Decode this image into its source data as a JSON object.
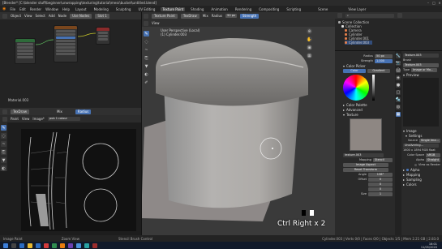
{
  "window": {
    "title": "[Blender* [C:\\blender stuff\\beginner\\unwrapping\\texturing\\tutorial\\mess\\bucket\\untitled.blend]"
  },
  "menu": [
    "File",
    "Edit",
    "Render",
    "Window",
    "Help"
  ],
  "workspace_tabs": [
    {
      "label": "Layout",
      "active": false
    },
    {
      "label": "Modeling",
      "active": false
    },
    {
      "label": "Sculpting",
      "active": false
    },
    {
      "label": "UV Editing",
      "active": false
    },
    {
      "label": "Texture Paint",
      "active": true
    },
    {
      "label": "Shading",
      "active": false
    },
    {
      "label": "Animation",
      "active": false
    },
    {
      "label": "Rendering",
      "active": false
    },
    {
      "label": "Compositing",
      "active": false
    },
    {
      "label": "Scripting",
      "active": false
    }
  ],
  "scene": {
    "label": "Scene",
    "view_layer": "View Layer"
  },
  "node_editor": {
    "header": [
      "Object",
      "View",
      "Select",
      "Add",
      "Node",
      "Use Nodes"
    ],
    "slot": "Slot 1",
    "material": "Material.003",
    "footer_label": "Material.003"
  },
  "image_editor": {
    "header": [
      "Paint",
      "View",
      "Image*"
    ],
    "image_name": "pub 1 colour",
    "brush": "TexDraw",
    "mode": "Mix",
    "radius_btn": "Radius"
  },
  "viewport": {
    "mode": "Texture Paint",
    "brush": "TexDraw",
    "blend": "Mix",
    "radius_label": "Radius",
    "radius_value": "50 px",
    "strength_label": "Strength",
    "menu": [
      "View"
    ],
    "info_line1": "User Perspective (Local)",
    "info_line2": "(1) Cylinder.003",
    "shortcut_overlay": "Ctrl Right x 2"
  },
  "outliner": {
    "title": "Scene Collection",
    "items": [
      {
        "label": "Scene Collection",
        "color": "#aaaaaa"
      },
      {
        "label": "Collection",
        "color": "#dddddd"
      },
      {
        "label": "Camera",
        "color": "#e07d4a"
      },
      {
        "label": "Cylinder",
        "color": "#e07d4a"
      },
      {
        "label": "Cylinder.001",
        "color": "#e07d4a"
      },
      {
        "label": "Cylinder.003",
        "color": "#e07d4a"
      }
    ]
  },
  "tool_settings": {
    "radius_label": "Radius",
    "radius_value": "50 px",
    "strength_label": "Strength",
    "strength_value": "1.000",
    "color_picker": "Color Picker",
    "color_tab": "Color",
    "gradient_tab": "Gradient",
    "sections": [
      "Color Palette",
      "Advanced",
      "Texture"
    ],
    "texture_name": "texture.003",
    "mapping_label": "Mapping",
    "mapping_value": "Stencil",
    "image_aspect": "Image Aspect",
    "reset_transform": "Reset Transform",
    "angle_label": "Angle",
    "angle_value": "138°",
    "offset_label": "Offset",
    "offset_values": [
      "0",
      "0",
      "0"
    ],
    "size_label": "Size",
    "size_values": [
      "1",
      "1",
      "1"
    ]
  },
  "texture_props": {
    "name": "Texture.003",
    "brush_label": "Brush",
    "type_label": "Type",
    "type_value": "Image or Mo...",
    "preview_label": "Preview",
    "image_label": "Image",
    "settings_label": "Settings",
    "source_label": "Source",
    "source_value": "Single Ima...",
    "image_file": "Unsilvering...",
    "resolution": "1600 x 1894  RGB float",
    "colorspace_label": "Color Space",
    "colorspace_value": "sRGB",
    "alpha_label": "Alpha",
    "alpha_value": "Straight",
    "view_as_render": "View as Render",
    "alpha_section": "Alpha",
    "mapping_section": "Mapping",
    "sampling_section": "Sampling",
    "colors_section": "Colors"
  },
  "status": {
    "left": "Image Paint",
    "middle": "Zoom View",
    "center": "Stencil Brush Control",
    "right": "Cylinder.003 | Verts 0/0 | Faces 0/0 | Objects 1/5 | Mem 2.21 GB | 2.83.0"
  },
  "clock": {
    "time": "16:01",
    "date": "11/05/2020"
  },
  "colors": {
    "accent": "#4772b3",
    "object_orange": "#e07d4a"
  }
}
